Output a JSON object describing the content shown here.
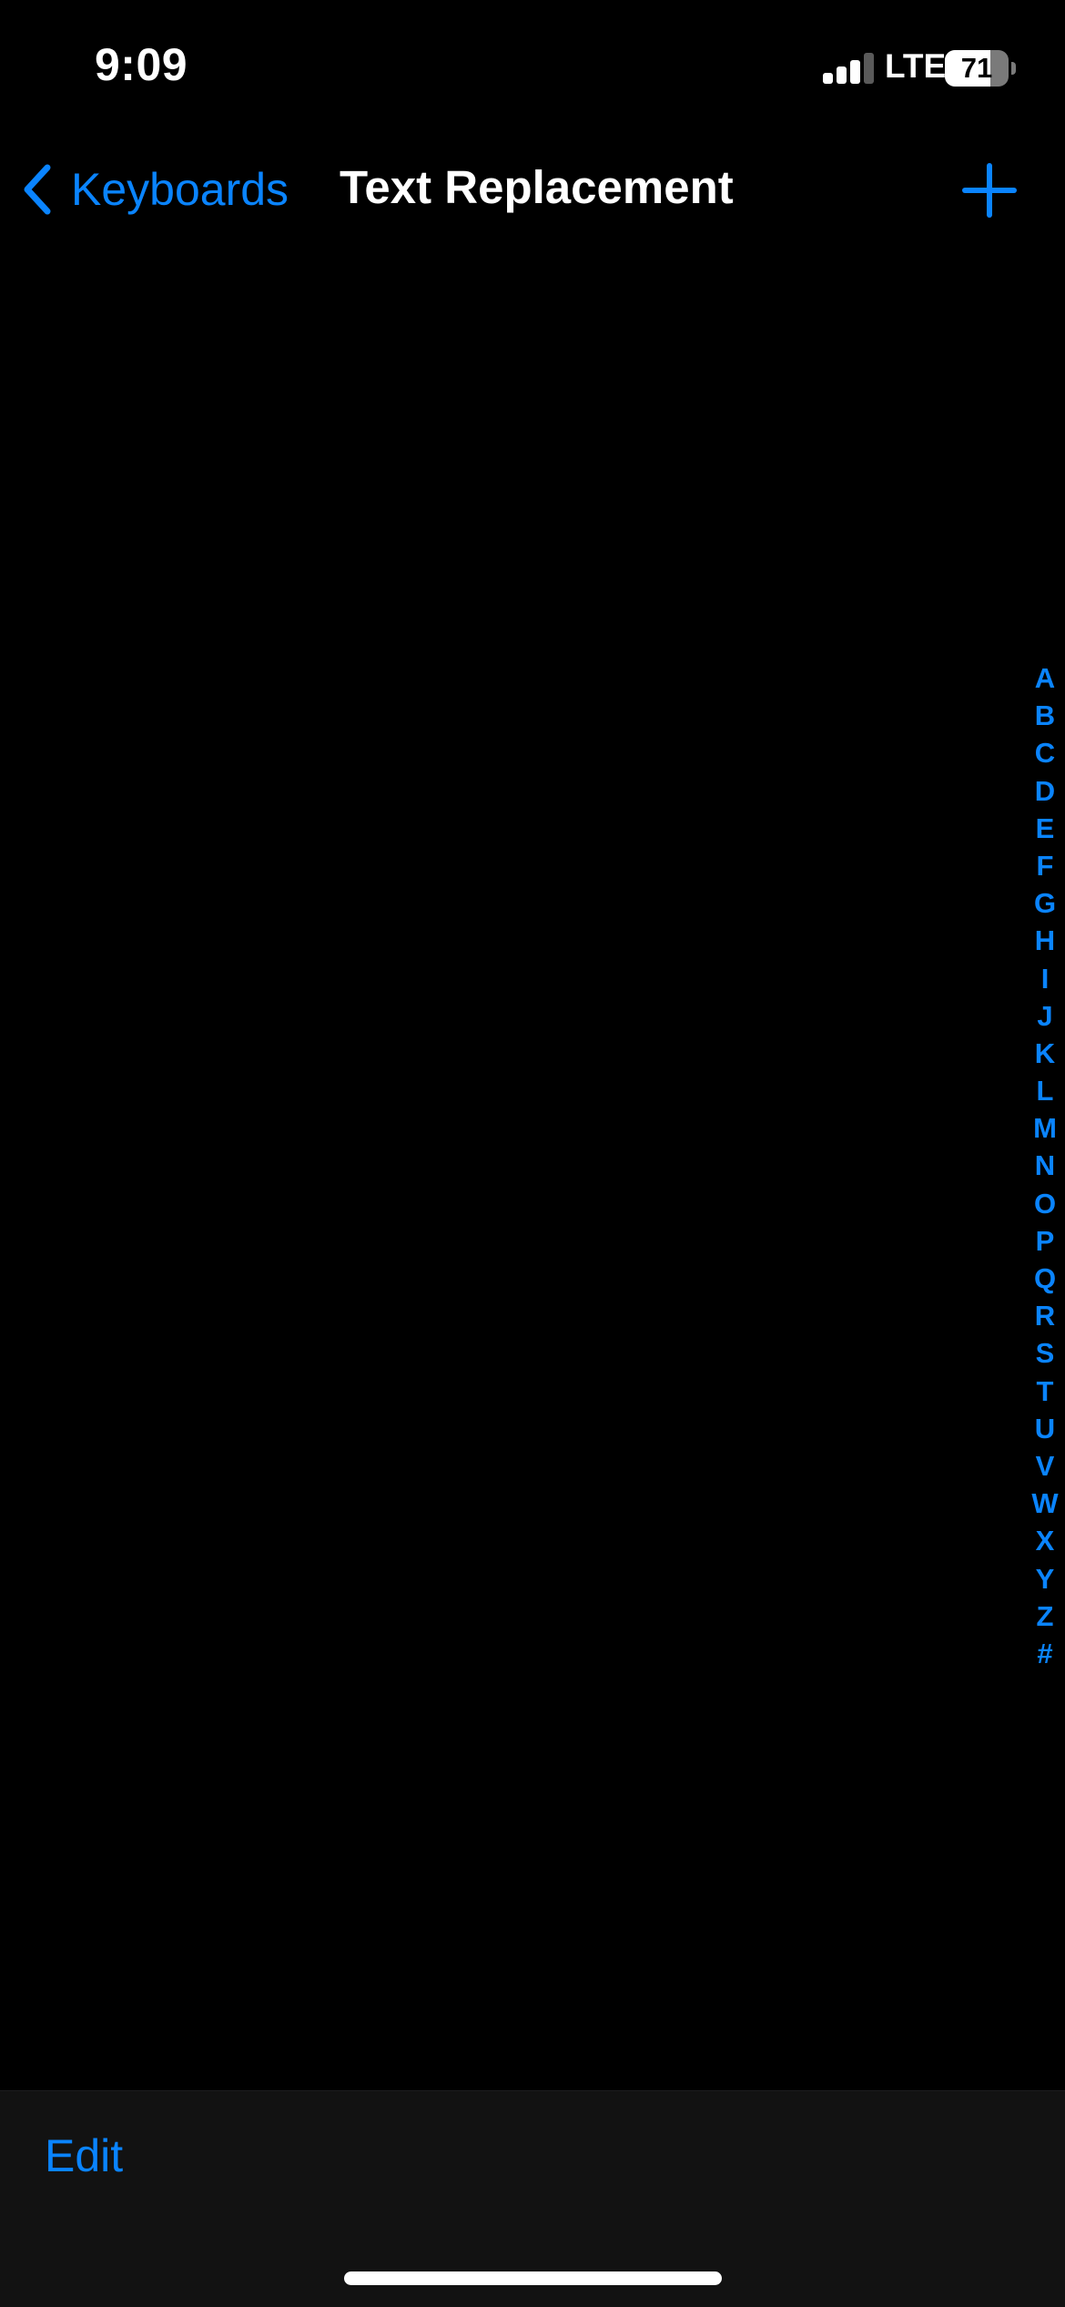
{
  "status_bar": {
    "time": "9:09",
    "network": "LTE",
    "battery_percent": "71",
    "battery_level": 0.71,
    "signal_bars_active": 3,
    "signal_bars_total": 4
  },
  "nav": {
    "back_label": "Keyboards",
    "title": "Text Replacement",
    "back_icon": "chevron-left-icon",
    "add_icon": "plus-icon"
  },
  "section_index": [
    "A",
    "B",
    "C",
    "D",
    "E",
    "F",
    "G",
    "H",
    "I",
    "J",
    "K",
    "L",
    "M",
    "N",
    "O",
    "P",
    "Q",
    "R",
    "S",
    "T",
    "U",
    "V",
    "W",
    "X",
    "Y",
    "Z",
    "#"
  ],
  "toolbar": {
    "edit_label": "Edit"
  },
  "colors": {
    "accent": "#0a84ff",
    "background": "#000000",
    "toolbar_background": "#121212",
    "text": "#ffffff"
  }
}
